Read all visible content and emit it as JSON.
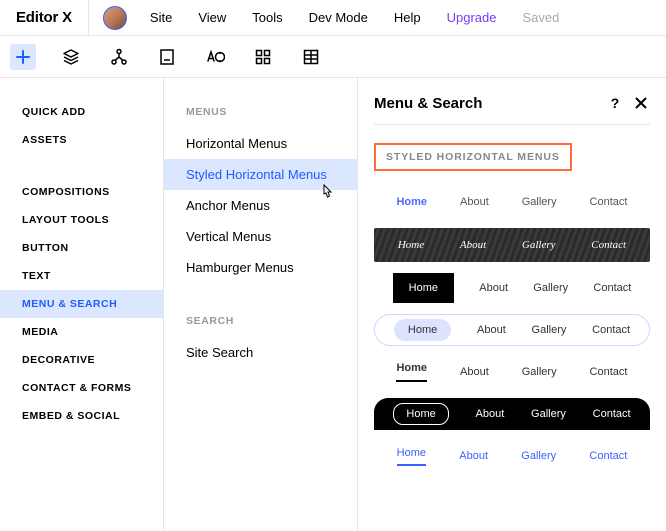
{
  "topbar": {
    "logo": "Editor X",
    "menu": [
      "Site",
      "View",
      "Tools",
      "Dev Mode",
      "Help"
    ],
    "upgrade": "Upgrade",
    "saved": "Saved"
  },
  "left": {
    "group1": [
      "QUICK ADD",
      "ASSETS"
    ],
    "group2": [
      "COMPOSITIONS",
      "LAYOUT TOOLS",
      "BUTTON",
      "TEXT",
      "MENU & SEARCH",
      "MEDIA",
      "DECORATIVE",
      "CONTACT & FORMS",
      "EMBED & SOCIAL"
    ],
    "active": "MENU & SEARCH"
  },
  "mid": {
    "heading1": "MENUS",
    "menus": [
      "Horizontal Menus",
      "Styled Horizontal Menus",
      "Anchor Menus",
      "Vertical Menus",
      "Hamburger Menus"
    ],
    "active": "Styled Horizontal Menus",
    "heading2": "SEARCH",
    "search": [
      "Site Search"
    ]
  },
  "panel": {
    "title": "Menu & Search",
    "section": "STYLED HORIZONTAL MENUS",
    "navItems": [
      "Home",
      "About",
      "Gallery",
      "Contact"
    ]
  }
}
